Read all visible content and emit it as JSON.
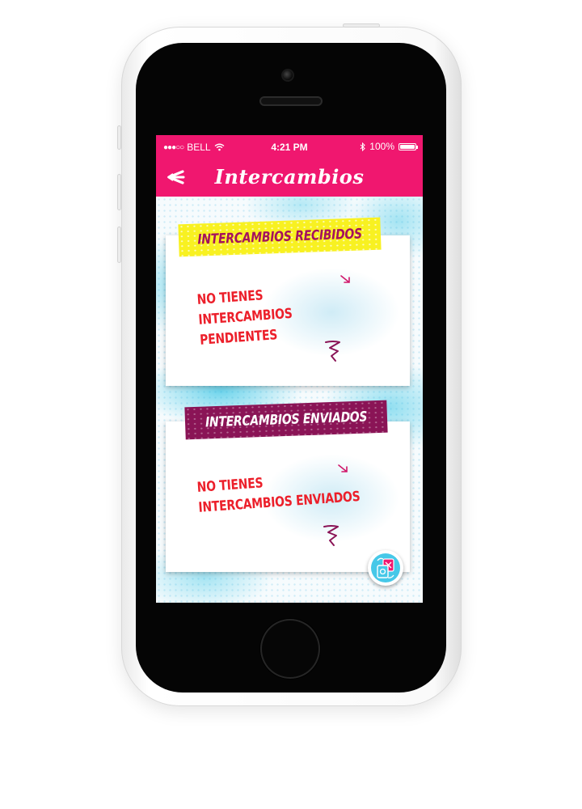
{
  "status_bar": {
    "signal": "●●●○○",
    "carrier": "BELL",
    "time": "4:21 PM",
    "battery_percent": "100%",
    "battery_level": 1.0
  },
  "nav": {
    "title": "Intercambios",
    "back_icon": "back-arrow-icon"
  },
  "sections": {
    "received": {
      "banner": "INTERCAMBIOS RECIBIDOS",
      "message_line1": "NO TIENES",
      "message_line2": "INTERCAMBIOS PENDIENTES"
    },
    "sent": {
      "banner": "INTERCAMBIOS ENVIADOS",
      "message_line1": "NO TIENES",
      "message_line2": "INTERCAMBIOS ENVIADOS"
    }
  },
  "fab": {
    "icon": "exchange-icon"
  },
  "colors": {
    "brand_pink": "#f0176f",
    "banner_yellow": "#f8f121",
    "banner_purple": "#8a1456",
    "message_red": "#ec1f2a",
    "accent_cyan": "#46c8e8"
  }
}
